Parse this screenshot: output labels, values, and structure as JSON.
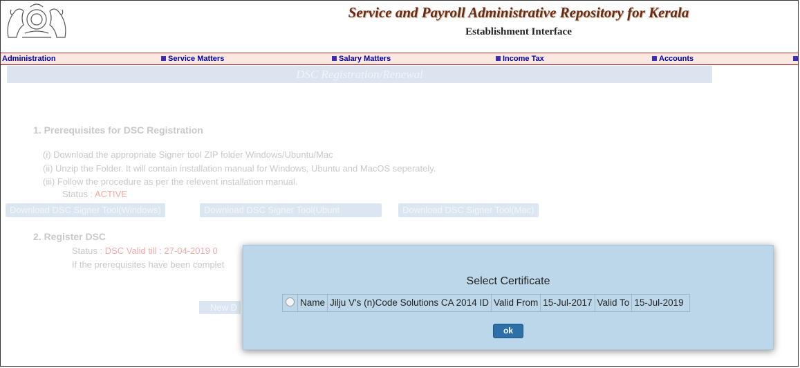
{
  "header": {
    "title": "Service and Payroll Administrative Repository for Kerala",
    "subtitle": "Establishment Interface"
  },
  "menu": [
    {
      "label": "Administration",
      "icon": false
    },
    {
      "label": "Service Matters",
      "icon": true
    },
    {
      "label": "Salary Matters",
      "icon": true
    },
    {
      "label": "Income Tax",
      "icon": true
    },
    {
      "label": "Accounts",
      "icon": true
    }
  ],
  "page": {
    "heading": "DSC Registration/Renewal",
    "section1": {
      "title": "1. Prerequisites for DSC Registration",
      "steps": [
        "(i)  Download the appropriate Signer tool ZIP folder Windows/Ubuntu/Mac",
        "(ii)  Unzip the Folder. It will contain installation manual for Windows, Ubuntu and MacOS seperately.",
        "(iii) Follow the procedure as per the relevent installation manual."
      ],
      "status_label": "Status :",
      "status_value": "ACTIVE",
      "buttons": [
        "Download DSC Signer Tool(Windows)",
        "Download DSC Signer Tool(Ubunt",
        "Download DSC Signer Tool(Mac)"
      ]
    },
    "section2": {
      "title": "2. Register DSC",
      "status_label": "Status :",
      "status_value": "DSC Valid till : 27-04-2019 0",
      "note": "If the prerequisites have been complet",
      "new_button": "New D"
    }
  },
  "dialog": {
    "title": "Select Certificate",
    "certificate": {
      "name_label": "Name",
      "name_value": "Jilju V's (n)Code Solutions CA 2014 ID",
      "valid_from_label": "Valid From",
      "valid_from_value": "15-Jul-2017",
      "valid_to_label": "Valid To",
      "valid_to_value": "15-Jul-2019",
      "selected": false
    },
    "ok_label": "ok"
  },
  "colors": {
    "title": "#6b2a14",
    "menu_text": "#0000a8",
    "dialog_bg": "#bdd7ea",
    "ok_button": "#2f6fa7"
  }
}
